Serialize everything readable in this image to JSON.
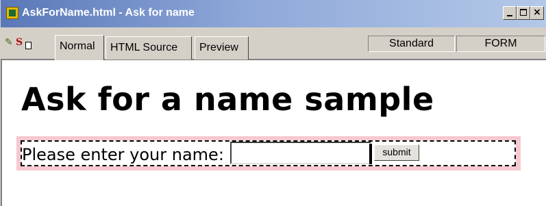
{
  "window": {
    "title": "AskForName.html - Ask for name",
    "controls": {
      "minimize": "_",
      "maximize": "□",
      "close": "×"
    },
    "icon": "app-document-icon"
  },
  "toolbar": {
    "icons": [
      "pencil-icon",
      "s-icon",
      "document-icon"
    ],
    "tabs": [
      {
        "label": "Normal",
        "active": true
      },
      {
        "label": "HTML Source",
        "active": false
      },
      {
        "label": "Preview",
        "active": false
      }
    ],
    "status": {
      "mode": "Standard",
      "element": "FORM"
    }
  },
  "document": {
    "heading": "Ask for a name sample",
    "form": {
      "prompt": "Please enter your name:",
      "input_value": "",
      "submit_label": "submit",
      "highlight_color": "#f6c8d0"
    }
  }
}
